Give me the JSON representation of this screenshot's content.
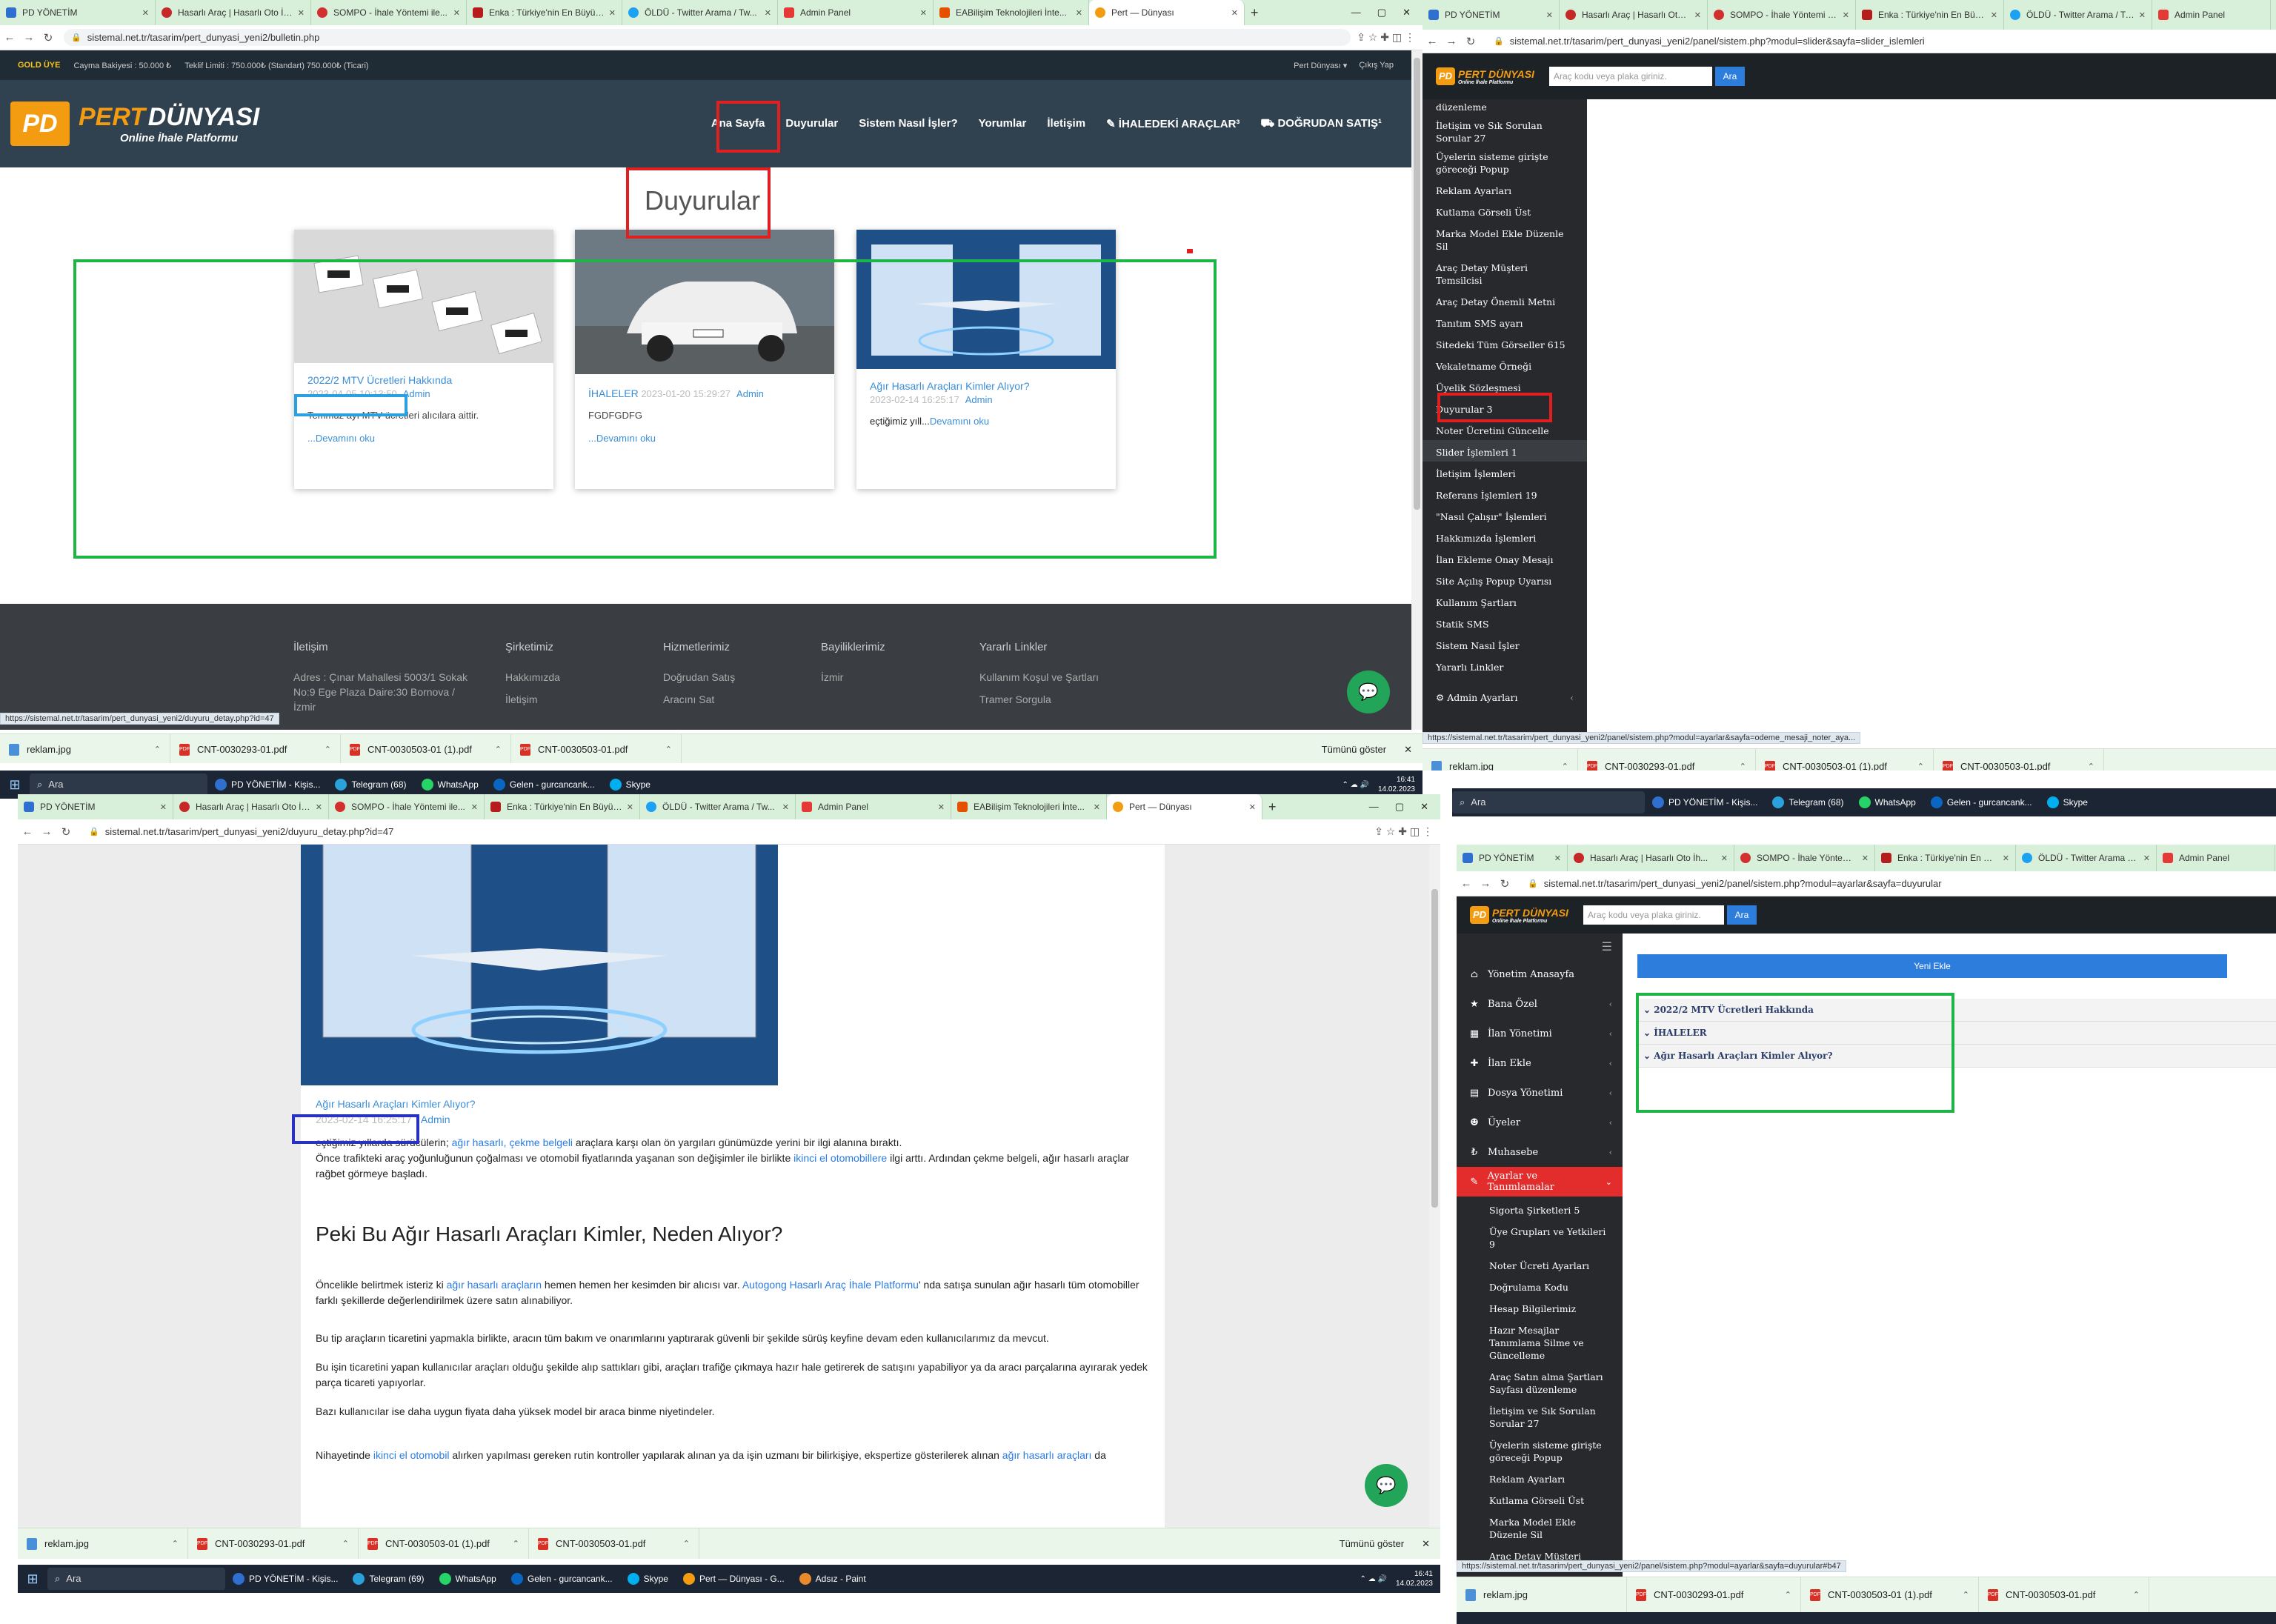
{
  "common": {
    "win_min": "—",
    "win_max": "▢",
    "win_close": "✕",
    "new_tab": "+",
    "tab_close": "✕",
    "nav_back": "←",
    "nav_fwd": "→",
    "nav_reload": "↻",
    "nav_lock": "🔒",
    "ext_icons": "⇪ ☆ ✚ ◫ ⋮",
    "start_icon": "⊞",
    "search_icon": "⌕",
    "search_label": "Ara",
    "show_all": "Tümünü göster",
    "dl_close": "✕",
    "time": "16:41",
    "date": "14.02.2023",
    "tray": "⌃ ☁ 🔊"
  },
  "tabs_main": [
    "PD YÖNETİM",
    "Hasarlı Araç | Hasarlı Oto İh...",
    "SOMPO - İhale Yöntemi ile...",
    "Enka : Türkiye'nin En Büyük...",
    "ÖLDÜ - Twitter Arama / Tw...",
    "Admin Panel",
    "EABilişim Teknolojileri İnte...",
    "Pert — Dünyası"
  ],
  "tabs_right": [
    "PD YÖNETİM",
    "Hasarlı Araç | Hasarlı Oto İh...",
    "SOMPO - İhale Yöntemi ile...",
    "Enka : Türkiye'nin En Büyük...",
    "ÖLDÜ - Twitter Arama / Tw...",
    "Admin Panel"
  ],
  "urls": {
    "w1": "sistemal.net.tr/tasarim/pert_dunyasi_yeni2/bulletin.php",
    "w2": "sistemal.net.tr/tasarim/pert_dunyasi_yeni2/panel/sistem.php?modul=slider&sayfa=slider_islemleri",
    "w3": "sistemal.net.tr/tasarim/pert_dunyasi_yeni2/duyuru_detay.php?id=47",
    "w4": "sistemal.net.tr/tasarim/pert_dunyasi_yeni2/panel/sistem.php?modul=ayarlar&sayfa=duyurular"
  },
  "status": {
    "w1": "https://sistemal.net.tr/tasarim/pert_dunyasi_yeni2/duyuru_detay.php?id=47",
    "w2": "https://sistemal.net.tr/tasarim/pert_dunyasi_yeni2/panel/sistem.php?modul=ayarlar&sayfa=odeme_mesaji_noter_aya...",
    "w4": "https://sistemal.net.tr/tasarim/pert_dunyasi_yeni2/panel/sistem.php?modul=ayarlar&sayfa=duyurular#b47"
  },
  "downloads": [
    "reklam.jpg",
    "CNT-0030293-01.pdf",
    "CNT-0030503-01 (1).pdf",
    "CNT-0030503-01.pdf"
  ],
  "taskbar_apps_1": [
    "PD YÖNETİM - Kişis...",
    "Telegram (68)",
    "WhatsApp",
    "Gelen - gurcancank...",
    "Skype"
  ],
  "taskbar_apps_2": [
    "PD YÖNETİM - Kişis...",
    "Telegram (69)",
    "WhatsApp",
    "Gelen - gurcancank...",
    "Skype",
    "Pert — Dünyası - G...",
    "Adsız - Paint"
  ],
  "site": {
    "topbar": {
      "gold": "GOLD ÜYE",
      "cayma": "Cayma Bakiyesi : 50.000 ₺",
      "teklif": "Teklif Limiti : 750.000₺ (Standart) 750.000₺ (Ticari)",
      "user": "Pert Dünyası ▾",
      "logout": "Çıkış Yap"
    },
    "logo": {
      "mark": "PD",
      "name1": "PERT",
      "name2": "DÜNYASI",
      "tagline": "Online İhale Platformu"
    },
    "menu": [
      "Ana Sayfa",
      "Duyurular",
      "Sistem Nasıl İşler?",
      "Yorumlar",
      "İletişim",
      "✎ İHALEDEKİ ARAÇLAR³",
      "⛟ DOĞRUDAN SATIŞ¹"
    ],
    "page_title": "Duyurular",
    "cards": [
      {
        "title": "2022/2 MTV Ücretleri Hakkında",
        "date": "2023-04-05 10:13:50",
        "author": "Admin",
        "excerpt": "Temmuz ayı MTV ücretleri alıcılara aittir.",
        "more": "...Devamını oku"
      },
      {
        "title": "İHALELER",
        "date": "2023-01-20 15:29:27",
        "author": "Admin",
        "excerpt": "FGDFGDFG",
        "more": "...Devamını oku"
      },
      {
        "title": "Ağır Hasarlı Araçları Kimler Alıyor?",
        "date": "2023-02-14 16:25:17",
        "author": "Admin",
        "excerpt": "eçtiğimiz yıll...",
        "more": "Devamını oku"
      }
    ],
    "footer": {
      "cols": [
        {
          "h": "İletişim",
          "items": [
            "Adres : Çınar Mahallesi 5003/1 Sokak",
            "No:9 Ege Plaza Daire:30 Bornova /",
            "İzmir"
          ]
        },
        {
          "h": "Şirketimiz",
          "items": [
            "Hakkımızda",
            "İletişim"
          ]
        },
        {
          "h": "Hizmetlerimiz",
          "items": [
            "Doğrudan Satış",
            "Aracını Sat"
          ]
        },
        {
          "h": "Bayiliklerimiz",
          "items": [
            "İzmir"
          ]
        },
        {
          "h": "Yararlı Linkler",
          "items": [
            "Kullanım Koşul ve Şartları",
            "Tramer Sorgula"
          ]
        }
      ]
    },
    "chat_icon": "💬"
  },
  "admin": {
    "logo_mark": "PD",
    "logo_name": "PERT DÜNYASI",
    "logo_tag": "Online İhale Platformu",
    "search_placeholder": "Araç kodu veya plaka giriniz.",
    "search_btn": "Ara",
    "side_items_w2": [
      "düzenleme",
      "İletişim ve Sık Sorulan Sorular 27",
      "Üyelerin sisteme girişte göreceği Popup",
      "Reklam Ayarları",
      "Kutlama Görseli Üst",
      "Marka Model Ekle Düzenle Sil",
      "Araç Detay Müşteri Temsilcisi",
      "Araç Detay Önemli Metni",
      "Tanıtım SMS ayarı",
      "Sitedeki Tüm Görseller 615",
      "Vekaletname Örneği",
      "Üyelik Sözleşmesi",
      "Duyurular 3",
      "Noter Ücretini Güncelle",
      "Slider İşlemleri 1",
      "İletişim İşlemleri",
      "Referans İşlemleri 19",
      "\"Nasıl Çalışır\" İşlemleri",
      "Hakkımızda İşlemleri",
      "İlan Ekleme Onay Mesajı",
      "Site Açılış Popup Uyarısı",
      "Kullanım Şartları",
      "Statik SMS",
      "Sistem Nasıl İşler",
      "Yararlı Linkler",
      "Admin Ayarları"
    ],
    "main_nav": [
      {
        "icon": "⌂",
        "label": "Yönetim Anasayfa"
      },
      {
        "icon": "★",
        "label": "Bana Özel"
      },
      {
        "icon": "▦",
        "label": "İlan Yönetimi"
      },
      {
        "icon": "✚",
        "label": "İlan Ekle"
      },
      {
        "icon": "▤",
        "label": "Dosya Yönetimi"
      },
      {
        "icon": "☻",
        "label": "Üyeler"
      },
      {
        "icon": "₺",
        "label": "Muhasebe"
      },
      {
        "icon": "✎",
        "label": "Ayarlar ve Tanımlamalar"
      }
    ],
    "sub_nav": [
      "Sigorta Şirketleri 5",
      "Üye Grupları ve Yetkileri 9",
      "Noter Ücreti Ayarları",
      "Doğrulama Kodu",
      "Hesap Bilgilerimiz",
      "Hazır Mesajlar Tanımlama Silme ve Güncelleme",
      "Araç Satın alma Şartları Sayfası düzenleme",
      "İletişim ve Sık Sorulan Sorular 27",
      "Üyelerin sisteme girişte göreceği Popup",
      "Reklam Ayarları",
      "Kutlama Görseli Üst",
      "Marka Model Ekle Düzenle Sil",
      "Araç Detay Müşteri Temsilcisi"
    ],
    "new_btn": "Yeni Ekle",
    "accordion": [
      "⌄ 2022/2 MTV Ücretleri Hakkında",
      "⌄ İHALELER",
      "⌄ Ağır Hasarlı Araçları Kimler Alıyor?"
    ]
  },
  "article": {
    "title": "Ağır Hasarlı Araçları Kimler Alıyor?",
    "date": "2023-02-14 16:25:17",
    "author": "Admin",
    "p1a": "eçtiğimiz yıllarda sürücülerin; ",
    "p1link": "ağır hasarlı, çekme belgeli",
    "p1b": " araçlara karşı olan ön yargıları günümüzde yerini bir ilgi alanına bıraktı.",
    "p1c": "Önce trafikteki araç yoğunluğunun çoğalması ve otomobil fiyatlarında yaşanan son değişimler ile birlikte ",
    "p1link2": "ikinci el otomobillere",
    "p1d": " ilgi arttı. Ardından çekme belgeli, ağır hasarlı araçlar rağbet görmeye başladı.",
    "h2": "Peki Bu Ağır Hasarlı Araçları Kimler, Neden Alıyor?",
    "p2a": "Öncelikle belirtmek isteriz ki ",
    "p2link": "ağır hasarlı araçların",
    "p2b": " hemen hemen her kesimden bir alıcısı var. ",
    "p2link2": "Autogong Hasarlı Araç İhale Platformu",
    "p2c": "' nda satışa sunulan ağır hasarlı tüm otomobiller farklı şekillerde değerlendirilmek üzere satın alınabiliyor.",
    "p3": "Bu tip araçların ticaretini yapmakla birlikte, aracın tüm bakım ve onarımlarını yaptırarak güvenli bir şekilde sürüş keyfine devam eden kullanıcılarımız da mevcut.",
    "p4": "Bu işin ticaretini yapan kullanıcılar araçları olduğu şekilde alıp sattıkları gibi, araçları trafiğe çıkmaya hazır hale getirerek de satışını yapabiliyor ya da aracı parçalarına ayırarak yedek parça ticareti yapıyorlar.",
    "p5": "Bazı kullanıcılar ise daha uygun fiyata daha yüksek model bir araca binme niyetindeler.",
    "p6a": "Nihayetinde ",
    "p6link": "ikinci el otomobil",
    "p6b": " alırken yapılması gereken rutin kontroller yapılarak alınan ya da işin uzmanı bir bilirkişiye, ekspertize gösterilerek alınan ",
    "p6link2": "ağır hasarlı araçları",
    "p6c": " da"
  },
  "colors": {
    "accent_orange": "#f39c12",
    "admin_red": "#e32d2d",
    "admin_blue": "#2d7ddd",
    "link_blue": "#2a7be4",
    "annot_red": "#e02020",
    "annot_green": "#1db546"
  }
}
